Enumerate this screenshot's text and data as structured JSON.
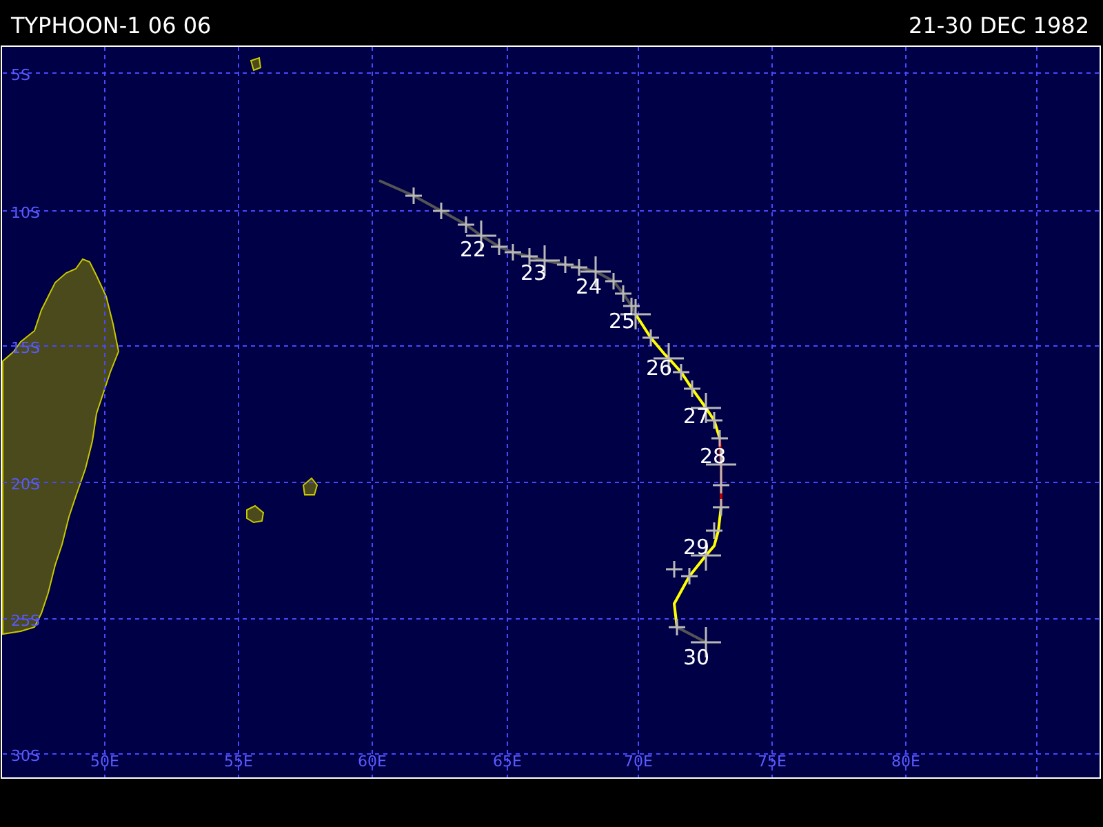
{
  "header": {
    "title": "TYPHOON-1 06 06",
    "date_range": "21-30 DEC 1982"
  },
  "map": {
    "latitude_labels": [
      "5S",
      "10S",
      "15S",
      "20S",
      "25S",
      "30S"
    ],
    "longitude_labels": [
      "50E",
      "55E",
      "60E",
      "65E",
      "70E",
      "75E",
      "80E"
    ],
    "day_labels": [
      "22",
      "23",
      "24",
      "25",
      "26",
      "27",
      "28",
      "29",
      "30"
    ],
    "track": [
      {
        "kind": "depression"
      },
      {
        "kind": "storm"
      },
      {
        "kind": "typhoon"
      },
      {
        "kind": "storm"
      },
      {
        "kind": "depression"
      }
    ]
  }
}
